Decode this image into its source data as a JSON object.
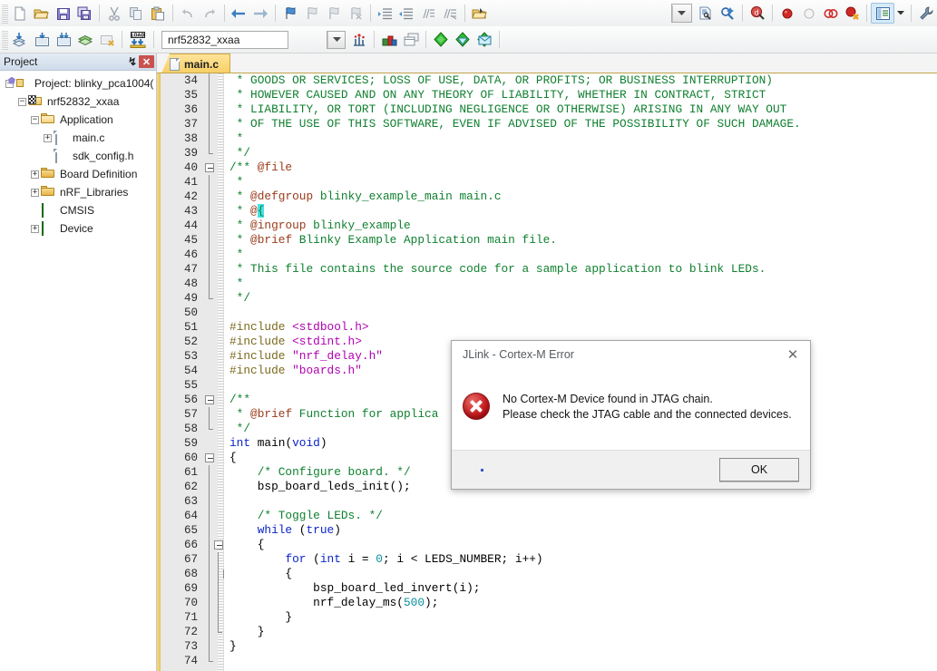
{
  "toolbar1": {
    "buttons": [
      {
        "name": "new-file-icon",
        "title": "New"
      },
      {
        "name": "open-file-icon",
        "title": "Open"
      },
      {
        "name": "save-icon",
        "title": "Save"
      },
      {
        "name": "save-all-icon",
        "title": "Save All"
      },
      {
        "name": "cut-icon",
        "title": "Cut"
      },
      {
        "name": "copy-icon",
        "title": "Copy"
      },
      {
        "name": "paste-icon",
        "title": "Paste"
      },
      {
        "name": "undo-icon",
        "title": "Undo"
      },
      {
        "name": "redo-icon",
        "title": "Redo"
      },
      {
        "name": "navigate-back-icon",
        "title": "Back"
      },
      {
        "name": "navigate-forward-icon",
        "title": "Forward"
      },
      {
        "name": "bookmark-toggle-icon",
        "title": "Insert/Remove Bookmark"
      },
      {
        "name": "bookmark-prev-icon",
        "title": "Previous Bookmark"
      },
      {
        "name": "bookmark-next-icon",
        "title": "Next Bookmark"
      },
      {
        "name": "bookmark-clear-icon",
        "title": "Clear All Bookmarks"
      },
      {
        "name": "indent-right-icon",
        "title": "Indent"
      },
      {
        "name": "indent-left-icon",
        "title": "Outdent"
      },
      {
        "name": "comment-icon",
        "title": "Comment"
      },
      {
        "name": "uncomment-icon",
        "title": "Uncomment"
      },
      {
        "name": "open-folder-icon",
        "title": "Open Project"
      },
      {
        "name": "build-output-combo",
        "title": "search-combo"
      },
      {
        "name": "find-in-files-icon",
        "title": "Find in Files"
      },
      {
        "name": "incremental-find-icon",
        "title": "Incremental Find"
      },
      {
        "name": "debug-start-icon",
        "title": "Start/Stop Debug Session"
      },
      {
        "name": "breakpoint-insert-icon",
        "title": "Insert/Remove Breakpoint"
      },
      {
        "name": "breakpoint-enable-icon",
        "title": "Enable/Disable Breakpoint"
      },
      {
        "name": "breakpoint-disable-all-icon",
        "title": "Disable All Breakpoints"
      },
      {
        "name": "breakpoint-kill-all-icon",
        "title": "Kill All Breakpoints"
      },
      {
        "name": "window-layout-icon",
        "title": "Manage Window Layout"
      },
      {
        "name": "configure-icon",
        "title": "Configure"
      }
    ]
  },
  "toolbar2": {
    "buttons": [
      {
        "name": "translate-icon",
        "title": "Translate Current File"
      },
      {
        "name": "build-icon",
        "title": "Build"
      },
      {
        "name": "rebuild-icon",
        "title": "Rebuild"
      },
      {
        "name": "batch-build-icon",
        "title": "Batch Build"
      },
      {
        "name": "stop-build-icon",
        "title": "Stop Build"
      },
      {
        "name": "load-icon",
        "title": "Download"
      },
      {
        "name": "target-options-icon",
        "title": "Options for Target"
      },
      {
        "name": "manage-project-items-icon",
        "title": "Manage Project Items"
      },
      {
        "name": "multi-project-icon",
        "title": "Multi-Project"
      },
      {
        "name": "pack-installer-icon",
        "title": "Pack Installer"
      },
      {
        "name": "manage-rte-icon",
        "title": "Manage Run-Time Environment"
      },
      {
        "name": "select-software-packs-icon",
        "title": "Select Software Packs"
      }
    ],
    "target_select": {
      "value": "nrf52832_xxaa",
      "placeholder": "Select Target"
    }
  },
  "project_panel": {
    "title": "Project",
    "pin_glyph": "↯",
    "close_glyph": "✕",
    "tree": [
      {
        "label": "Project: blinky_pca1004(",
        "icon": "project-icon",
        "depth": 0,
        "expander": "minus"
      },
      {
        "label": "nrf52832_xxaa",
        "icon": "target-icon",
        "depth": 1,
        "expander": "minus"
      },
      {
        "label": "Application",
        "icon": "folder-open-icon",
        "depth": 2,
        "expander": "minus"
      },
      {
        "label": "main.c",
        "icon": "c-file-icon",
        "depth": 3,
        "expander": "plus"
      },
      {
        "label": "sdk_config.h",
        "icon": "h-file-icon",
        "depth": 3,
        "expander": "none"
      },
      {
        "label": "Board Definition",
        "icon": "folder-closed-icon",
        "depth": 2,
        "expander": "plus"
      },
      {
        "label": "nRF_Libraries",
        "icon": "folder-closed-icon",
        "depth": 2,
        "expander": "plus"
      },
      {
        "label": "CMSIS",
        "icon": "component-icon",
        "depth": 2,
        "expander": "none"
      },
      {
        "label": "Device",
        "icon": "component-icon",
        "depth": 2,
        "expander": "plus"
      }
    ]
  },
  "editor": {
    "tabs": [
      {
        "label": "main.c",
        "icon": "c-file-icon",
        "active": true
      }
    ],
    "first_line_number": 34,
    "lines": [
      {
        "n": 34,
        "fold": "bar",
        "tokens": [
          {
            "t": " * GOODS OR SERVICES; LOSS OF USE, DATA, OR PROFITS; OR BUSINESS INTERRUPTION)",
            "c": "c-cmt"
          }
        ]
      },
      {
        "n": 35,
        "fold": "bar",
        "tokens": [
          {
            "t": " * HOWEVER CAUSED AND ON ANY THEORY OF LIABILITY, WHETHER IN CONTRACT, STRICT",
            "c": "c-cmt"
          }
        ]
      },
      {
        "n": 36,
        "fold": "bar",
        "tokens": [
          {
            "t": " * LIABILITY, OR TORT (INCLUDING NEGLIGENCE OR OTHERWISE) ARISING IN ANY WAY OUT",
            "c": "c-cmt"
          }
        ]
      },
      {
        "n": 37,
        "fold": "bar",
        "tokens": [
          {
            "t": " * OF THE USE OF THIS SOFTWARE, EVEN IF ADVISED OF THE POSSIBILITY OF SUCH DAMAGE.",
            "c": "c-cmt"
          }
        ]
      },
      {
        "n": 38,
        "fold": "bar",
        "tokens": [
          {
            "t": " *",
            "c": "c-cmt"
          }
        ]
      },
      {
        "n": 39,
        "fold": "end",
        "tokens": [
          {
            "t": " */",
            "c": "c-cmt"
          }
        ]
      },
      {
        "n": 40,
        "fold": "box",
        "tokens": [
          {
            "t": "/** ",
            "c": "c-cmt"
          },
          {
            "t": "@file",
            "c": "c-dox"
          }
        ]
      },
      {
        "n": 41,
        "fold": "bar",
        "tokens": [
          {
            "t": " *",
            "c": "c-cmt"
          }
        ]
      },
      {
        "n": 42,
        "fold": "bar",
        "tokens": [
          {
            "t": " * ",
            "c": "c-cmt"
          },
          {
            "t": "@defgroup",
            "c": "c-dox"
          },
          {
            "t": " blinky_example_main main.c",
            "c": "c-cmt"
          }
        ]
      },
      {
        "n": 43,
        "fold": "bar",
        "tokens": [
          {
            "t": " * ",
            "c": "c-cmt"
          },
          {
            "t": "@",
            "c": "c-dox"
          },
          {
            "t": "{",
            "c": "c-hl"
          }
        ]
      },
      {
        "n": 44,
        "fold": "bar",
        "tokens": [
          {
            "t": " * ",
            "c": "c-cmt"
          },
          {
            "t": "@ingroup",
            "c": "c-dox"
          },
          {
            "t": " blinky_example",
            "c": "c-cmt"
          }
        ]
      },
      {
        "n": 45,
        "fold": "bar",
        "tokens": [
          {
            "t": " * ",
            "c": "c-cmt"
          },
          {
            "t": "@brief",
            "c": "c-dox"
          },
          {
            "t": " Blinky Example Application main file.",
            "c": "c-cmt"
          }
        ]
      },
      {
        "n": 46,
        "fold": "bar",
        "tokens": [
          {
            "t": " *",
            "c": "c-cmt"
          }
        ]
      },
      {
        "n": 47,
        "fold": "bar",
        "tokens": [
          {
            "t": " * This file contains the source code for a sample application to blink LEDs.",
            "c": "c-cmt"
          }
        ]
      },
      {
        "n": 48,
        "fold": "bar",
        "tokens": [
          {
            "t": " *",
            "c": "c-cmt"
          }
        ]
      },
      {
        "n": 49,
        "fold": "end",
        "tokens": [
          {
            "t": " */",
            "c": "c-cmt"
          }
        ]
      },
      {
        "n": 50,
        "fold": "none",
        "tokens": []
      },
      {
        "n": 51,
        "fold": "none",
        "tokens": [
          {
            "t": "#include",
            "c": "c-pre"
          },
          {
            "t": " ",
            "c": ""
          },
          {
            "t": "<stdbool.h>",
            "c": "c-str"
          }
        ]
      },
      {
        "n": 52,
        "fold": "none",
        "tokens": [
          {
            "t": "#include",
            "c": "c-pre"
          },
          {
            "t": " ",
            "c": ""
          },
          {
            "t": "<stdint.h>",
            "c": "c-str"
          }
        ]
      },
      {
        "n": 53,
        "fold": "none",
        "tokens": [
          {
            "t": "#include",
            "c": "c-pre"
          },
          {
            "t": " ",
            "c": ""
          },
          {
            "t": "\"nrf_delay.h\"",
            "c": "c-str"
          }
        ]
      },
      {
        "n": 54,
        "fold": "none",
        "tokens": [
          {
            "t": "#include",
            "c": "c-pre"
          },
          {
            "t": " ",
            "c": ""
          },
          {
            "t": "\"boards.h\"",
            "c": "c-str"
          }
        ]
      },
      {
        "n": 55,
        "fold": "none",
        "tokens": []
      },
      {
        "n": 56,
        "fold": "box",
        "tokens": [
          {
            "t": "/**",
            "c": "c-cmt"
          }
        ]
      },
      {
        "n": 57,
        "fold": "bar",
        "tokens": [
          {
            "t": " * ",
            "c": "c-cmt"
          },
          {
            "t": "@brief",
            "c": "c-dox"
          },
          {
            "t": " Function for applica",
            "c": "c-cmt"
          }
        ]
      },
      {
        "n": 58,
        "fold": "end",
        "tokens": [
          {
            "t": " */",
            "c": "c-cmt"
          }
        ]
      },
      {
        "n": 59,
        "fold": "none",
        "tokens": [
          {
            "t": "int",
            "c": "c-kw"
          },
          {
            "t": " main(",
            "c": ""
          },
          {
            "t": "void",
            "c": "c-kw"
          },
          {
            "t": ")",
            "c": ""
          }
        ]
      },
      {
        "n": 60,
        "fold": "box",
        "tokens": [
          {
            "t": "{",
            "c": ""
          }
        ]
      },
      {
        "n": 61,
        "fold": "bar",
        "tokens": [
          {
            "t": "    ",
            "c": ""
          },
          {
            "t": "/* Configure board. */",
            "c": "c-cmt"
          }
        ]
      },
      {
        "n": 62,
        "fold": "bar",
        "tokens": [
          {
            "t": "    bsp_board_leds_init();",
            "c": ""
          }
        ]
      },
      {
        "n": 63,
        "fold": "bar",
        "tokens": []
      },
      {
        "n": 64,
        "fold": "bar",
        "tokens": [
          {
            "t": "    ",
            "c": ""
          },
          {
            "t": "/* Toggle LEDs. */",
            "c": "c-cmt"
          }
        ]
      },
      {
        "n": 65,
        "fold": "bar",
        "tokens": [
          {
            "t": "    ",
            "c": ""
          },
          {
            "t": "while",
            "c": "c-kw"
          },
          {
            "t": " (",
            "c": ""
          },
          {
            "t": "true",
            "c": "c-kw"
          },
          {
            "t": ")",
            "c": ""
          }
        ]
      },
      {
        "n": 66,
        "fold": "box2",
        "tokens": [
          {
            "t": "    {",
            "c": ""
          }
        ]
      },
      {
        "n": 67,
        "fold": "bar2",
        "tokens": [
          {
            "t": "        ",
            "c": ""
          },
          {
            "t": "for",
            "c": "c-kw"
          },
          {
            "t": " (",
            "c": ""
          },
          {
            "t": "int",
            "c": "c-kw"
          },
          {
            "t": " i = ",
            "c": ""
          },
          {
            "t": "0",
            "c": "c-num"
          },
          {
            "t": "; i < LEDS_NUMBER; i++)",
            "c": ""
          }
        ]
      },
      {
        "n": 68,
        "fold": "box3",
        "tokens": [
          {
            "t": "        {",
            "c": ""
          }
        ]
      },
      {
        "n": 69,
        "fold": "bar3",
        "tokens": [
          {
            "t": "            bsp_board_led_invert(i);",
            "c": ""
          }
        ]
      },
      {
        "n": 70,
        "fold": "bar3",
        "tokens": [
          {
            "t": "            nrf_delay_ms(",
            "c": ""
          },
          {
            "t": "500",
            "c": "c-num"
          },
          {
            "t": ");",
            "c": ""
          }
        ]
      },
      {
        "n": 71,
        "fold": "end3",
        "tokens": [
          {
            "t": "        }",
            "c": ""
          }
        ]
      },
      {
        "n": 72,
        "fold": "end2",
        "tokens": [
          {
            "t": "    }",
            "c": ""
          }
        ]
      },
      {
        "n": 73,
        "fold": "bar",
        "tokens": [
          {
            "t": "}",
            "c": ""
          }
        ]
      },
      {
        "n": 74,
        "fold": "end",
        "tokens": []
      }
    ]
  },
  "dialog": {
    "title": "JLink - Cortex-M Error",
    "close_glyph": "✕",
    "icon": "error-icon",
    "message_line1": "No Cortex-M Device found in JTAG chain.",
    "message_line2": "Please check the JTAG cable and the connected devices.",
    "ok_label": "OK"
  },
  "colors": {
    "comment": "#108030",
    "doxygen_tag": "#9a3b1b",
    "preprocessor": "#7a6a1e",
    "string": "#b000b0",
    "keyword": "#0a24c8",
    "number": "#0a8f9c",
    "highlight": "#46e0e8",
    "tab_active": "#f7cf63",
    "error_red": "#c0161a",
    "panel_header": "#cfdceb"
  }
}
